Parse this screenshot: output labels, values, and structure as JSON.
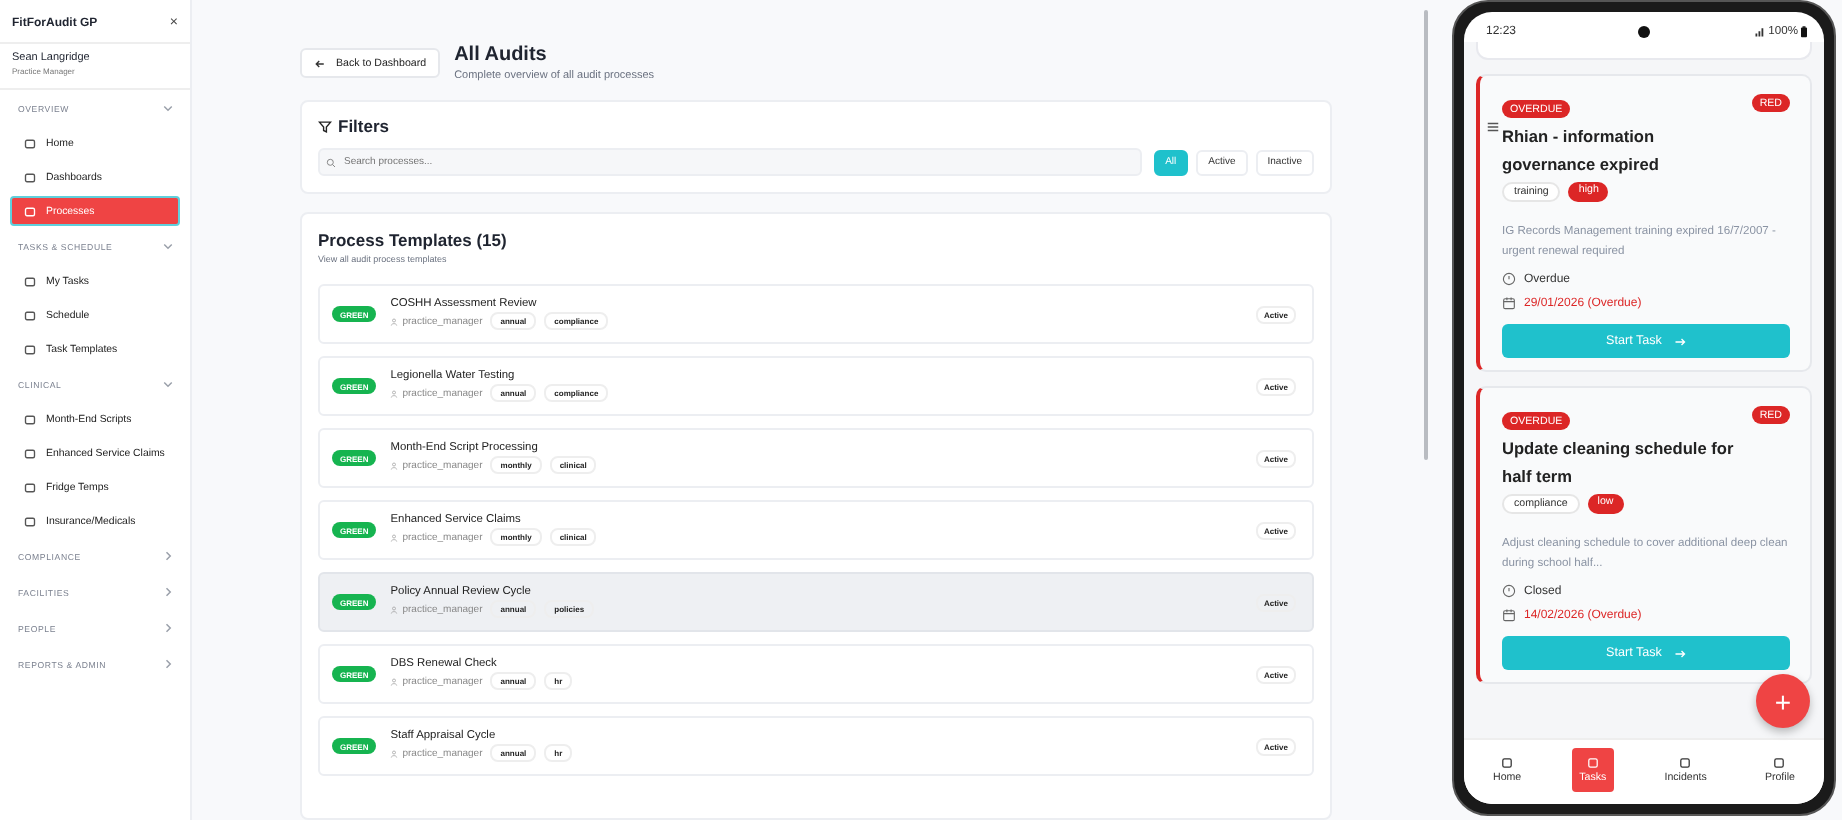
{
  "sidebar": {
    "app_title": "FitForAudit GP",
    "close": "×",
    "user": {
      "name": "Sean Langridge",
      "role": "Practice Manager"
    },
    "sections": [
      {
        "label": "OVERVIEW",
        "expanded": true,
        "items": [
          {
            "label": "Home",
            "selected": false
          },
          {
            "label": "Dashboards",
            "selected": false
          },
          {
            "label": "Processes",
            "selected": true
          }
        ]
      },
      {
        "label": "TASKS & SCHEDULE",
        "expanded": true,
        "items": [
          {
            "label": "My Tasks",
            "selected": false
          },
          {
            "label": "Schedule",
            "selected": false
          },
          {
            "label": "Task Templates",
            "selected": false
          }
        ]
      },
      {
        "label": "CLINICAL",
        "expanded": true,
        "items": [
          {
            "label": "Month-End Scripts",
            "selected": false
          },
          {
            "label": "Enhanced Service Claims",
            "selected": false
          },
          {
            "label": "Fridge Temps",
            "selected": false
          },
          {
            "label": "Insurance/Medicals",
            "selected": false
          }
        ]
      },
      {
        "label": "COMPLIANCE",
        "expanded": false
      },
      {
        "label": "FACILITIES",
        "expanded": false
      },
      {
        "label": "PEOPLE",
        "expanded": false
      },
      {
        "label": "REPORTS & ADMIN",
        "expanded": false
      }
    ]
  },
  "header": {
    "back_button": "Back to Dashboard",
    "title": "All Audits",
    "subtitle": "Complete overview of all audit processes"
  },
  "filters": {
    "title": "Filters",
    "search": {
      "placeholder": "Search processes..."
    },
    "options": [
      {
        "label": "All",
        "selected": true
      },
      {
        "label": "Active",
        "selected": false
      },
      {
        "label": "Inactive",
        "selected": false
      }
    ]
  },
  "templates": {
    "title": "Process Templates (15)",
    "subtitle": "View all audit process templates",
    "rows": [
      {
        "rag": "GREEN",
        "name": "COSHH Assessment Review",
        "owner": "practice_manager",
        "tags": [
          "annual",
          "compliance"
        ],
        "status": "Active",
        "hovered": false
      },
      {
        "rag": "GREEN",
        "name": "Legionella Water Testing",
        "owner": "practice_manager",
        "tags": [
          "annual",
          "compliance"
        ],
        "status": "Active",
        "hovered": false
      },
      {
        "rag": "GREEN",
        "name": "Month-End Script Processing",
        "owner": "practice_manager",
        "tags": [
          "monthly",
          "clinical"
        ],
        "status": "Active",
        "hovered": false
      },
      {
        "rag": "GREEN",
        "name": "Enhanced Service Claims",
        "owner": "practice_manager",
        "tags": [
          "monthly",
          "clinical"
        ],
        "status": "Active",
        "hovered": false
      },
      {
        "rag": "GREEN",
        "name": "Policy Annual Review Cycle",
        "owner": "practice_manager",
        "tags": [
          "annual",
          "policies"
        ],
        "status": "Active",
        "hovered": true
      },
      {
        "rag": "GREEN",
        "name": "DBS Renewal Check",
        "owner": "practice_manager",
        "tags": [
          "annual",
          "hr"
        ],
        "status": "Active",
        "hovered": false
      },
      {
        "rag": "GREEN",
        "name": "Staff Appraisal Cycle",
        "owner": "practice_manager",
        "tags": [
          "annual",
          "hr"
        ],
        "status": "Active",
        "hovered": false
      }
    ]
  },
  "phone": {
    "time": "12:23",
    "battery": "100%",
    "tasks": [
      {
        "badge": "OVERDUE",
        "rag": "RED",
        "title": "Rhian - information governance expired",
        "tags": [
          {
            "label": "training",
            "kind": "category"
          },
          {
            "label": "high",
            "kind": "priority"
          }
        ],
        "description": "IG Records Management training expired 16/7/2007 - urgent renewal required",
        "state": "Overdue",
        "due": "29/01/2026 (Overdue)",
        "button": "Start Task"
      },
      {
        "badge": "OVERDUE",
        "rag": "RED",
        "title": "Update cleaning schedule for half term",
        "tags": [
          {
            "label": "compliance",
            "kind": "category"
          },
          {
            "label": "low",
            "kind": "priority"
          }
        ],
        "description": "Adjust cleaning schedule to cover additional deep clean during school half...",
        "state": "Closed",
        "due": "14/02/2026 (Overdue)",
        "button": "Start Task"
      }
    ],
    "fab": "+",
    "nav": [
      {
        "label": "Home",
        "selected": false
      },
      {
        "label": "Tasks",
        "selected": true
      },
      {
        "label": "Incidents",
        "selected": false
      },
      {
        "label": "Profile",
        "selected": false
      }
    ]
  }
}
